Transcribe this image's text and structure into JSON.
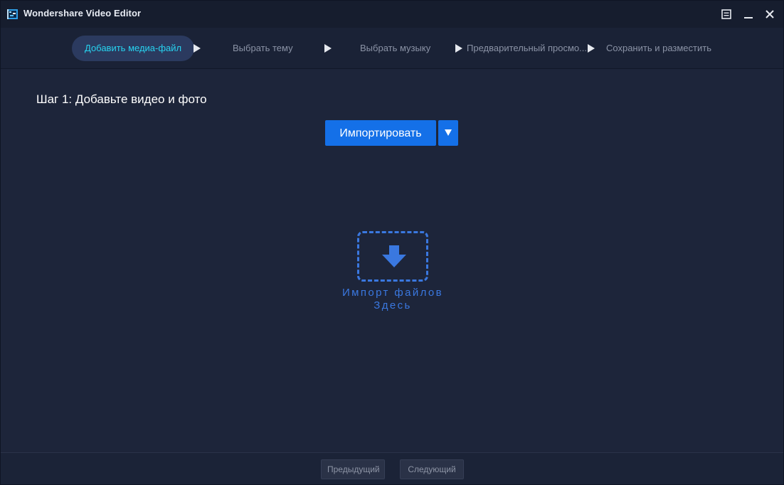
{
  "window": {
    "title": "Wondershare Video Editor",
    "icons": {
      "app": "app-logo-icon",
      "menu": "menu-icon",
      "minimize": "minimize-icon",
      "close": "close-icon"
    }
  },
  "steps": [
    {
      "label": "Добавить медиа-файл",
      "active": true
    },
    {
      "label": "Выбрать тему",
      "active": false
    },
    {
      "label": "Выбрать музыку",
      "active": false
    },
    {
      "label": "Предварительный просмо...",
      "active": false
    },
    {
      "label": "Сохранить и разместить",
      "active": false
    }
  ],
  "content": {
    "heading": "Шаг 1: Добавьте видео и фото",
    "import_label": "Импортировать",
    "drop_line1": "Импорт файлов",
    "drop_line2": "Здесь"
  },
  "footer": {
    "prev_label": "Предыдущий",
    "next_label": "Следующий"
  },
  "colors": {
    "accent": "#1470e8",
    "active_step_text": "#27d3f0",
    "drop_zone": "#3a78e0"
  }
}
